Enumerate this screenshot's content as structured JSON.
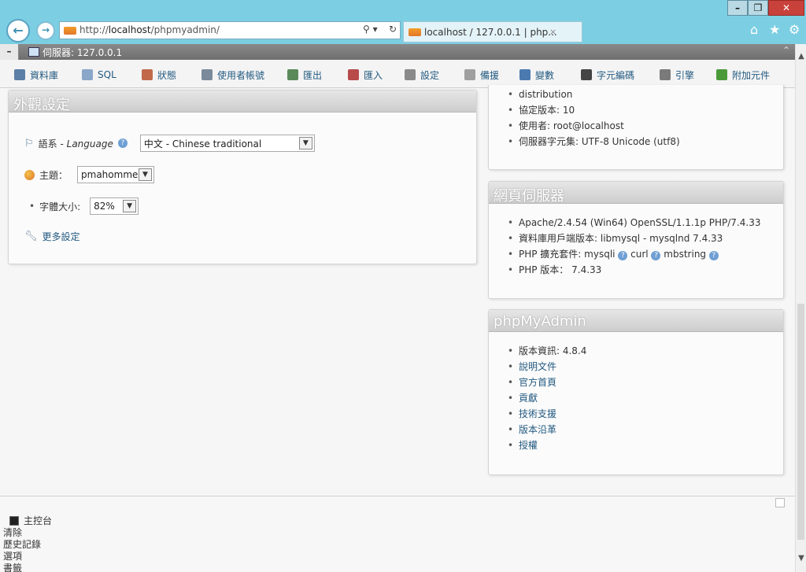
{
  "browser": {
    "window_controls": {
      "minimize": "–",
      "maximize": "❐",
      "close": "✕"
    },
    "back_glyph": "←",
    "forward_glyph": "→",
    "address": {
      "prefix": "http://",
      "host": "localhost",
      "path": "/phpmyadmin/"
    },
    "search_glyph": "⚲ ▾",
    "refresh_glyph": "↻",
    "tab": {
      "title": "localhost / 127.0.0.1 | php...",
      "close": "×"
    },
    "icons": {
      "home": "⌂",
      "star": "★",
      "settings": "⚙"
    }
  },
  "topbar": {
    "collapse": "–",
    "server_label": "伺服器: 127.0.0.1",
    "up": "⌃"
  },
  "menu": {
    "items": [
      {
        "label": "資料庫",
        "icon_color": "#5b7fa6"
      },
      {
        "label": "SQL",
        "icon_color": "#8aa6c8"
      },
      {
        "label": "狀態",
        "icon_color": "#c06a4a"
      },
      {
        "label": "使用者帳號",
        "icon_color": "#7a8a9a"
      },
      {
        "label": "匯出",
        "icon_color": "#5a8a5a"
      },
      {
        "label": "匯入",
        "icon_color": "#b84a4a"
      },
      {
        "label": "設定",
        "icon_color": "#8a8a8a"
      },
      {
        "label": "備援",
        "icon_color": "#a0a0a0"
      },
      {
        "label": "變數",
        "icon_color": "#4a7ab0"
      },
      {
        "label": "字元編碼",
        "icon_color": "#444444"
      },
      {
        "label": "引擎",
        "icon_color": "#7a7a7a"
      },
      {
        "label": "附加元件",
        "icon_color": "#4a9a3a"
      }
    ]
  },
  "appearance": {
    "title": "外觀設定",
    "language": {
      "label": "語系",
      "label_en": "Language",
      "value": "中文 - Chinese traditional"
    },
    "theme": {
      "label": "主題：",
      "value": "pmahomme"
    },
    "font_size": {
      "label": "字體大小:",
      "value": "82%"
    },
    "more": "更多設定"
  },
  "db_server": {
    "items": [
      "distribution",
      "協定版本: 10",
      "使用者: root@localhost",
      "伺服器字元集: UTF-8 Unicode (utf8)"
    ]
  },
  "web_server": {
    "title": "網頁伺服器",
    "items": [
      "Apache/2.4.54 (Win64) OpenSSL/1.1.1p PHP/7.4.33",
      "資料庫用戶端版本: libmysql - mysqlnd 7.4.33",
      "PHP 擴充套件: mysqli",
      "PHP 版本： 7.4.33"
    ],
    "ext_curl": "curl",
    "ext_mbstring": "mbstring"
  },
  "pma": {
    "title": "phpMyAdmin",
    "version": "版本資訊: 4.8.4",
    "links": [
      "說明文件",
      "官方首頁",
      "貢獻",
      "技術支援",
      "版本沿革",
      "授權"
    ]
  },
  "console": {
    "toggle": "主控台",
    "links": [
      "清除",
      "歷史記錄",
      "選項",
      "書籤"
    ]
  }
}
